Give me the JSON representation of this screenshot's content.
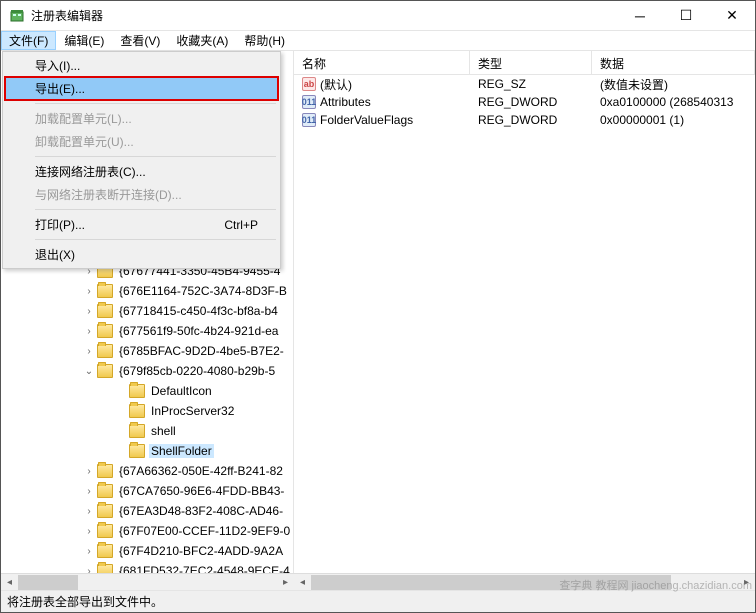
{
  "window": {
    "title": "注册表编辑器"
  },
  "menubar": {
    "items": [
      {
        "label": "文件(F)"
      },
      {
        "label": "编辑(E)"
      },
      {
        "label": "查看(V)"
      },
      {
        "label": "收藏夹(A)"
      },
      {
        "label": "帮助(H)"
      }
    ]
  },
  "file_menu": {
    "import": "导入(I)...",
    "export": "导出(E)...",
    "load_hive": "加载配置单元(L)...",
    "unload_hive": "卸载配置单元(U)...",
    "connect": "连接网络注册表(C)...",
    "disconnect": "与网络注册表断开连接(D)...",
    "print": "打印(P)...",
    "print_shortcut": "Ctrl+P",
    "exit": "退出(X)"
  },
  "tree": {
    "items": [
      {
        "indent": 82,
        "expander": "›",
        "label": "{67677441-3350-45B4-9455-4"
      },
      {
        "indent": 82,
        "expander": "›",
        "label": "{676E1164-752C-3A74-8D3F-B"
      },
      {
        "indent": 82,
        "expander": "›",
        "label": "{67718415-c450-4f3c-bf8a-b4"
      },
      {
        "indent": 82,
        "expander": "›",
        "label": "{677561f9-50fc-4b24-921d-ea"
      },
      {
        "indent": 82,
        "expander": "›",
        "label": "{6785BFAC-9D2D-4be5-B7E2-"
      },
      {
        "indent": 82,
        "expander": "⌄",
        "label": "{679f85cb-0220-4080-b29b-5"
      },
      {
        "indent": 114,
        "expander": "",
        "label": "DefaultIcon"
      },
      {
        "indent": 114,
        "expander": "",
        "label": "InProcServer32"
      },
      {
        "indent": 114,
        "expander": "",
        "label": "shell"
      },
      {
        "indent": 114,
        "expander": "",
        "label": "ShellFolder",
        "selected": true
      },
      {
        "indent": 82,
        "expander": "›",
        "label": "{67A66362-050E-42ff-B241-82"
      },
      {
        "indent": 82,
        "expander": "›",
        "label": "{67CA7650-96E6-4FDD-BB43-"
      },
      {
        "indent": 82,
        "expander": "›",
        "label": "{67EA3D48-83F2-408C-AD46-"
      },
      {
        "indent": 82,
        "expander": "›",
        "label": "{67F07E00-CCEF-11D2-9EF9-0"
      },
      {
        "indent": 82,
        "expander": "›",
        "label": "{67F4D210-BFC2-4ADD-9A2A"
      },
      {
        "indent": 82,
        "expander": "›",
        "label": "{681FD532-7EC2-4548-9ECE-4"
      }
    ]
  },
  "list": {
    "headers": {
      "name": "名称",
      "type": "类型",
      "data": "数据"
    },
    "rows": [
      {
        "icon": "str",
        "name": "(默认)",
        "type": "REG_SZ",
        "data": "(数值未设置)"
      },
      {
        "icon": "bin",
        "name": "Attributes",
        "type": "REG_DWORD",
        "data": "0xa0100000 (268540313"
      },
      {
        "icon": "bin",
        "name": "FolderValueFlags",
        "type": "REG_DWORD",
        "data": "0x00000001 (1)"
      }
    ]
  },
  "statusbar": {
    "text": "将注册表全部导出到文件中。"
  },
  "watermark": "查字典 教程网 jiaocheng.chazidian.com"
}
